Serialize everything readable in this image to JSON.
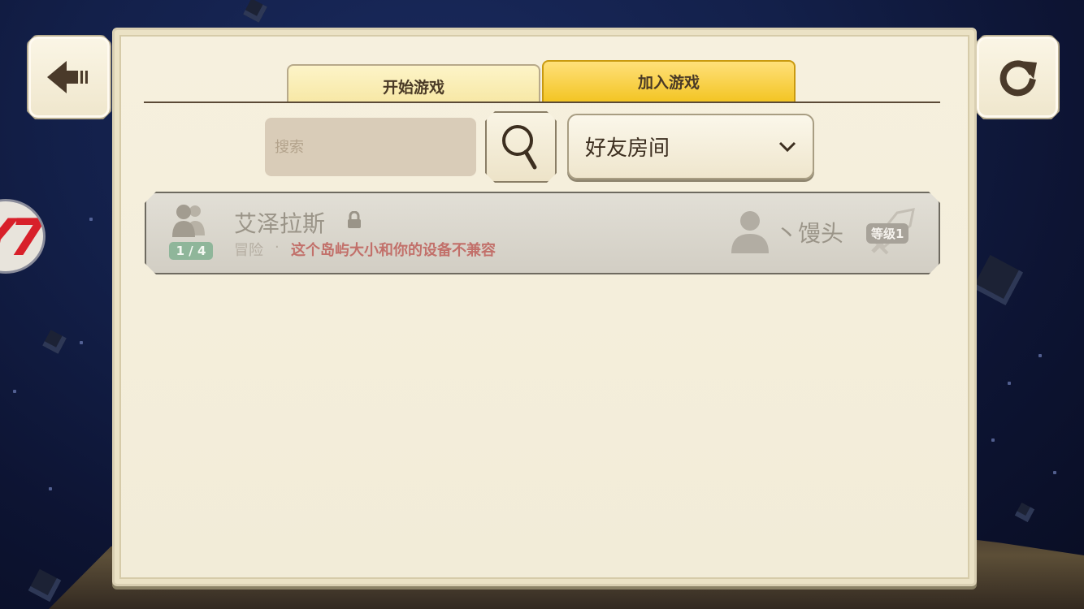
{
  "nav": {
    "back_icon": "arrow-left-icon",
    "refresh_icon": "refresh-icon"
  },
  "side_logo": {
    "text": "Y7"
  },
  "tabs": [
    {
      "label": "开始游戏",
      "active": false
    },
    {
      "label": "加入游戏",
      "active": true
    }
  ],
  "search": {
    "placeholder": "搜索",
    "value": "",
    "button_icon": "search-icon"
  },
  "room_filter": {
    "selected": "好友房间",
    "icon": "chevron-down-icon"
  },
  "rooms": [
    {
      "name": "艾泽拉斯",
      "locked": true,
      "player_count": "1 / 4",
      "mode": "冒险",
      "separator": "·",
      "warning": "这个岛屿大小和你的设备不兼容",
      "host": "丶馒头",
      "level": "等级1"
    }
  ],
  "colors": {
    "active_tab": "#f3c524",
    "inactive_tab": "#f7e8a6",
    "panel_bg": "#f4eedb",
    "warning_text": "#c2706a",
    "player_count_badge": "#8fb69a"
  }
}
